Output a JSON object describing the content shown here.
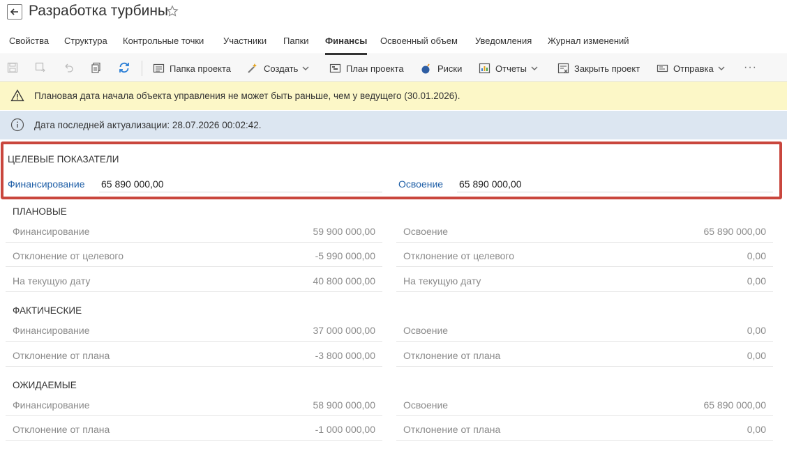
{
  "header": {
    "title": "Разработка турбины"
  },
  "tabs": [
    {
      "label": "Свойства",
      "active": false
    },
    {
      "label": "Структура",
      "active": false
    },
    {
      "label": "Контрольные точки",
      "active": false
    },
    {
      "label": "Участники",
      "active": false
    },
    {
      "label": "Папки",
      "active": false
    },
    {
      "label": "Финансы",
      "active": true
    },
    {
      "label": "Освоенный объем",
      "active": false
    },
    {
      "label": "Уведомления",
      "active": false
    },
    {
      "label": "Журнал изменений",
      "active": false
    }
  ],
  "toolbar": {
    "project_folder": "Папка проекта",
    "create": "Создать",
    "project_plan": "План проекта",
    "risks": "Риски",
    "reports": "Отчеты",
    "close_project": "Закрыть проект",
    "send": "Отправка",
    "more": "···"
  },
  "banners": {
    "warning": "Плановая дата начала объекта управления не может быть раньше, чем у ведущего (30.01.2026).",
    "info": "Дата последней актуализации: 28.07.2026 00:02:42."
  },
  "target": {
    "title": "ЦЕЛЕВЫЕ ПОКАЗАТЕЛИ",
    "financing_label": "Финансирование",
    "financing_value": "65 890 000,00",
    "mastering_label": "Освоение",
    "mastering_value": "65 890 000,00"
  },
  "planned": {
    "title": "ПЛАНОВЫЕ",
    "left": [
      {
        "label": "Финансирование",
        "value": "59 900 000,00"
      },
      {
        "label": "Отклонение от целевого",
        "value": "-5 990 000,00"
      },
      {
        "label": "На текущую дату",
        "value": "40 800 000,00"
      }
    ],
    "right": [
      {
        "label": "Освоение",
        "value": "65 890 000,00"
      },
      {
        "label": "Отклонение от целевого",
        "value": "0,00"
      },
      {
        "label": "На текущую дату",
        "value": "0,00"
      }
    ]
  },
  "actual": {
    "title": "ФАКТИЧЕСКИЕ",
    "left": [
      {
        "label": "Финансирование",
        "value": "37 000 000,00"
      },
      {
        "label": "Отклонение от плана",
        "value": "-3 800 000,00"
      }
    ],
    "right": [
      {
        "label": "Освоение",
        "value": "0,00"
      },
      {
        "label": "Отклонение от плана",
        "value": "0,00"
      }
    ]
  },
  "expected": {
    "title": "ОЖИДАЕМЫЕ",
    "left": [
      {
        "label": "Финансирование",
        "value": "58 900 000,00"
      },
      {
        "label": "Отклонение от плана",
        "value": "-1 000 000,00"
      }
    ],
    "right": [
      {
        "label": "Освоение",
        "value": "65 890 000,00"
      },
      {
        "label": "Отклонение от плана",
        "value": "0,00"
      }
    ]
  }
}
